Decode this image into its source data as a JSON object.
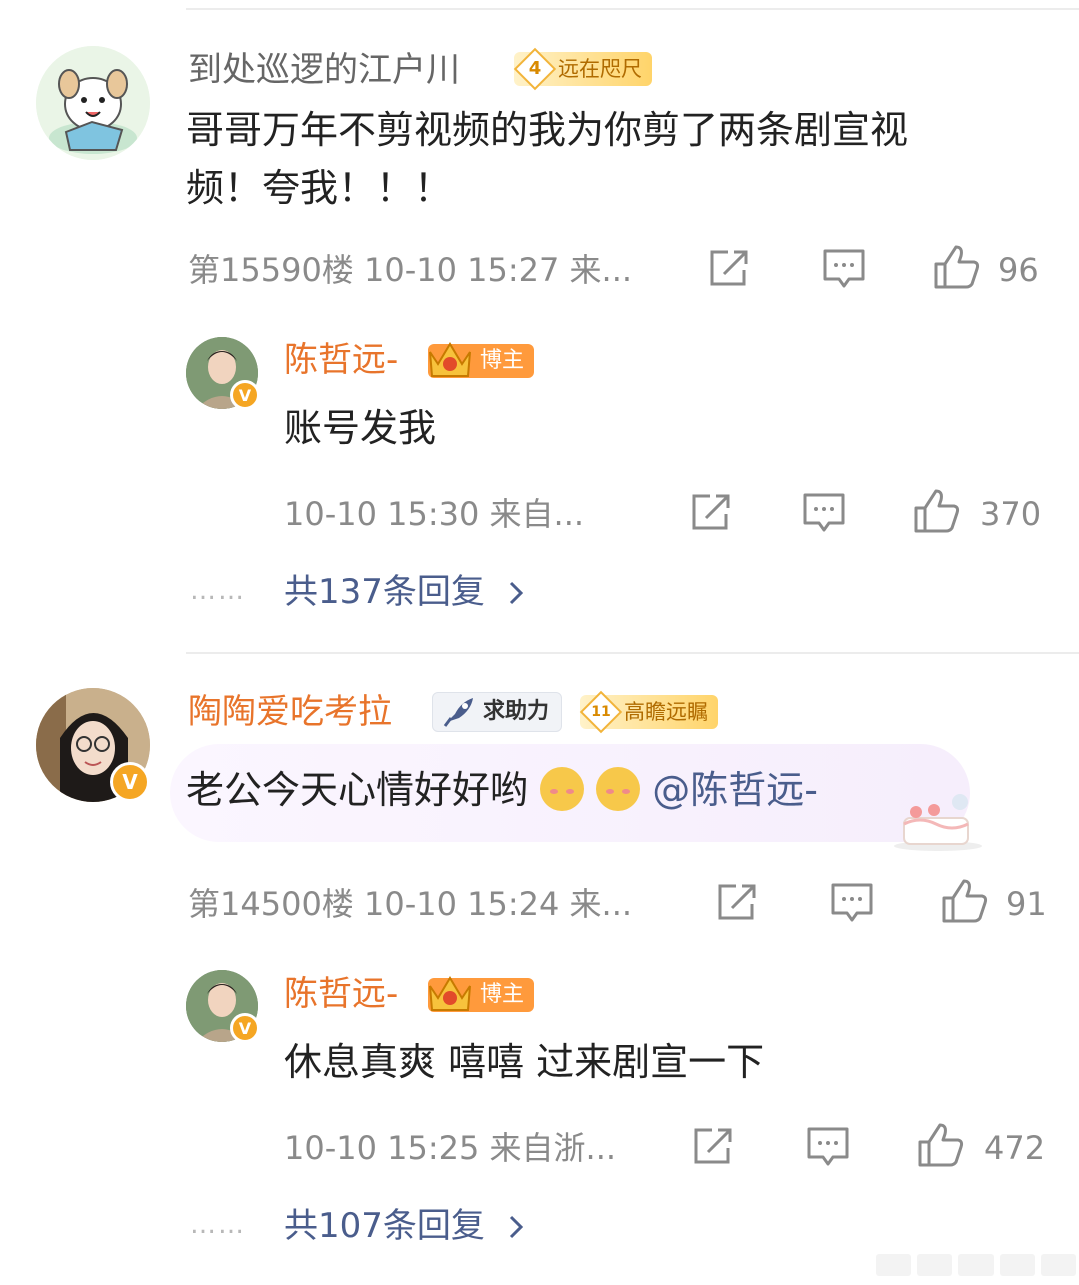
{
  "comments": [
    {
      "username": "到处巡逻的江户川",
      "fan_badge": {
        "level": "4",
        "label": "远在咫尺"
      },
      "text_line1": "哥哥万年不剪视频的我为你剪了两条剧宣视",
      "text_line2": "频！夸我！！！",
      "meta": "第15590楼 10-10 15:27 来...",
      "likes": "96",
      "reply": {
        "username": "陈哲远-",
        "badge": "博主",
        "text": "账号发我",
        "meta": "10-10 15:30 来自...",
        "likes": "370"
      },
      "more_replies": "共137条回复",
      "dots": "……"
    },
    {
      "username": "陶陶爱吃考拉",
      "help_badge": "求助力",
      "fan_badge": {
        "level": "11",
        "label": "高瞻远瞩"
      },
      "text": "老公今天心情好好哟",
      "mention": "@陈哲远-",
      "meta": "第14500楼 10-10 15:24 来...",
      "likes": "91",
      "reply": {
        "username": "陈哲远-",
        "badge": "博主",
        "text": "休息真爽 嘻嘻 过来剧宣一下",
        "meta": "10-10 15:25 来自浙...",
        "likes": "472"
      },
      "more_replies": "共107条回复",
      "dots": "……"
    }
  ],
  "colors": {
    "orange_name": "#e8742b",
    "link_blue": "#4a5d8c",
    "meta_gray": "#8a8a8a",
    "verified": "#f5a623"
  }
}
